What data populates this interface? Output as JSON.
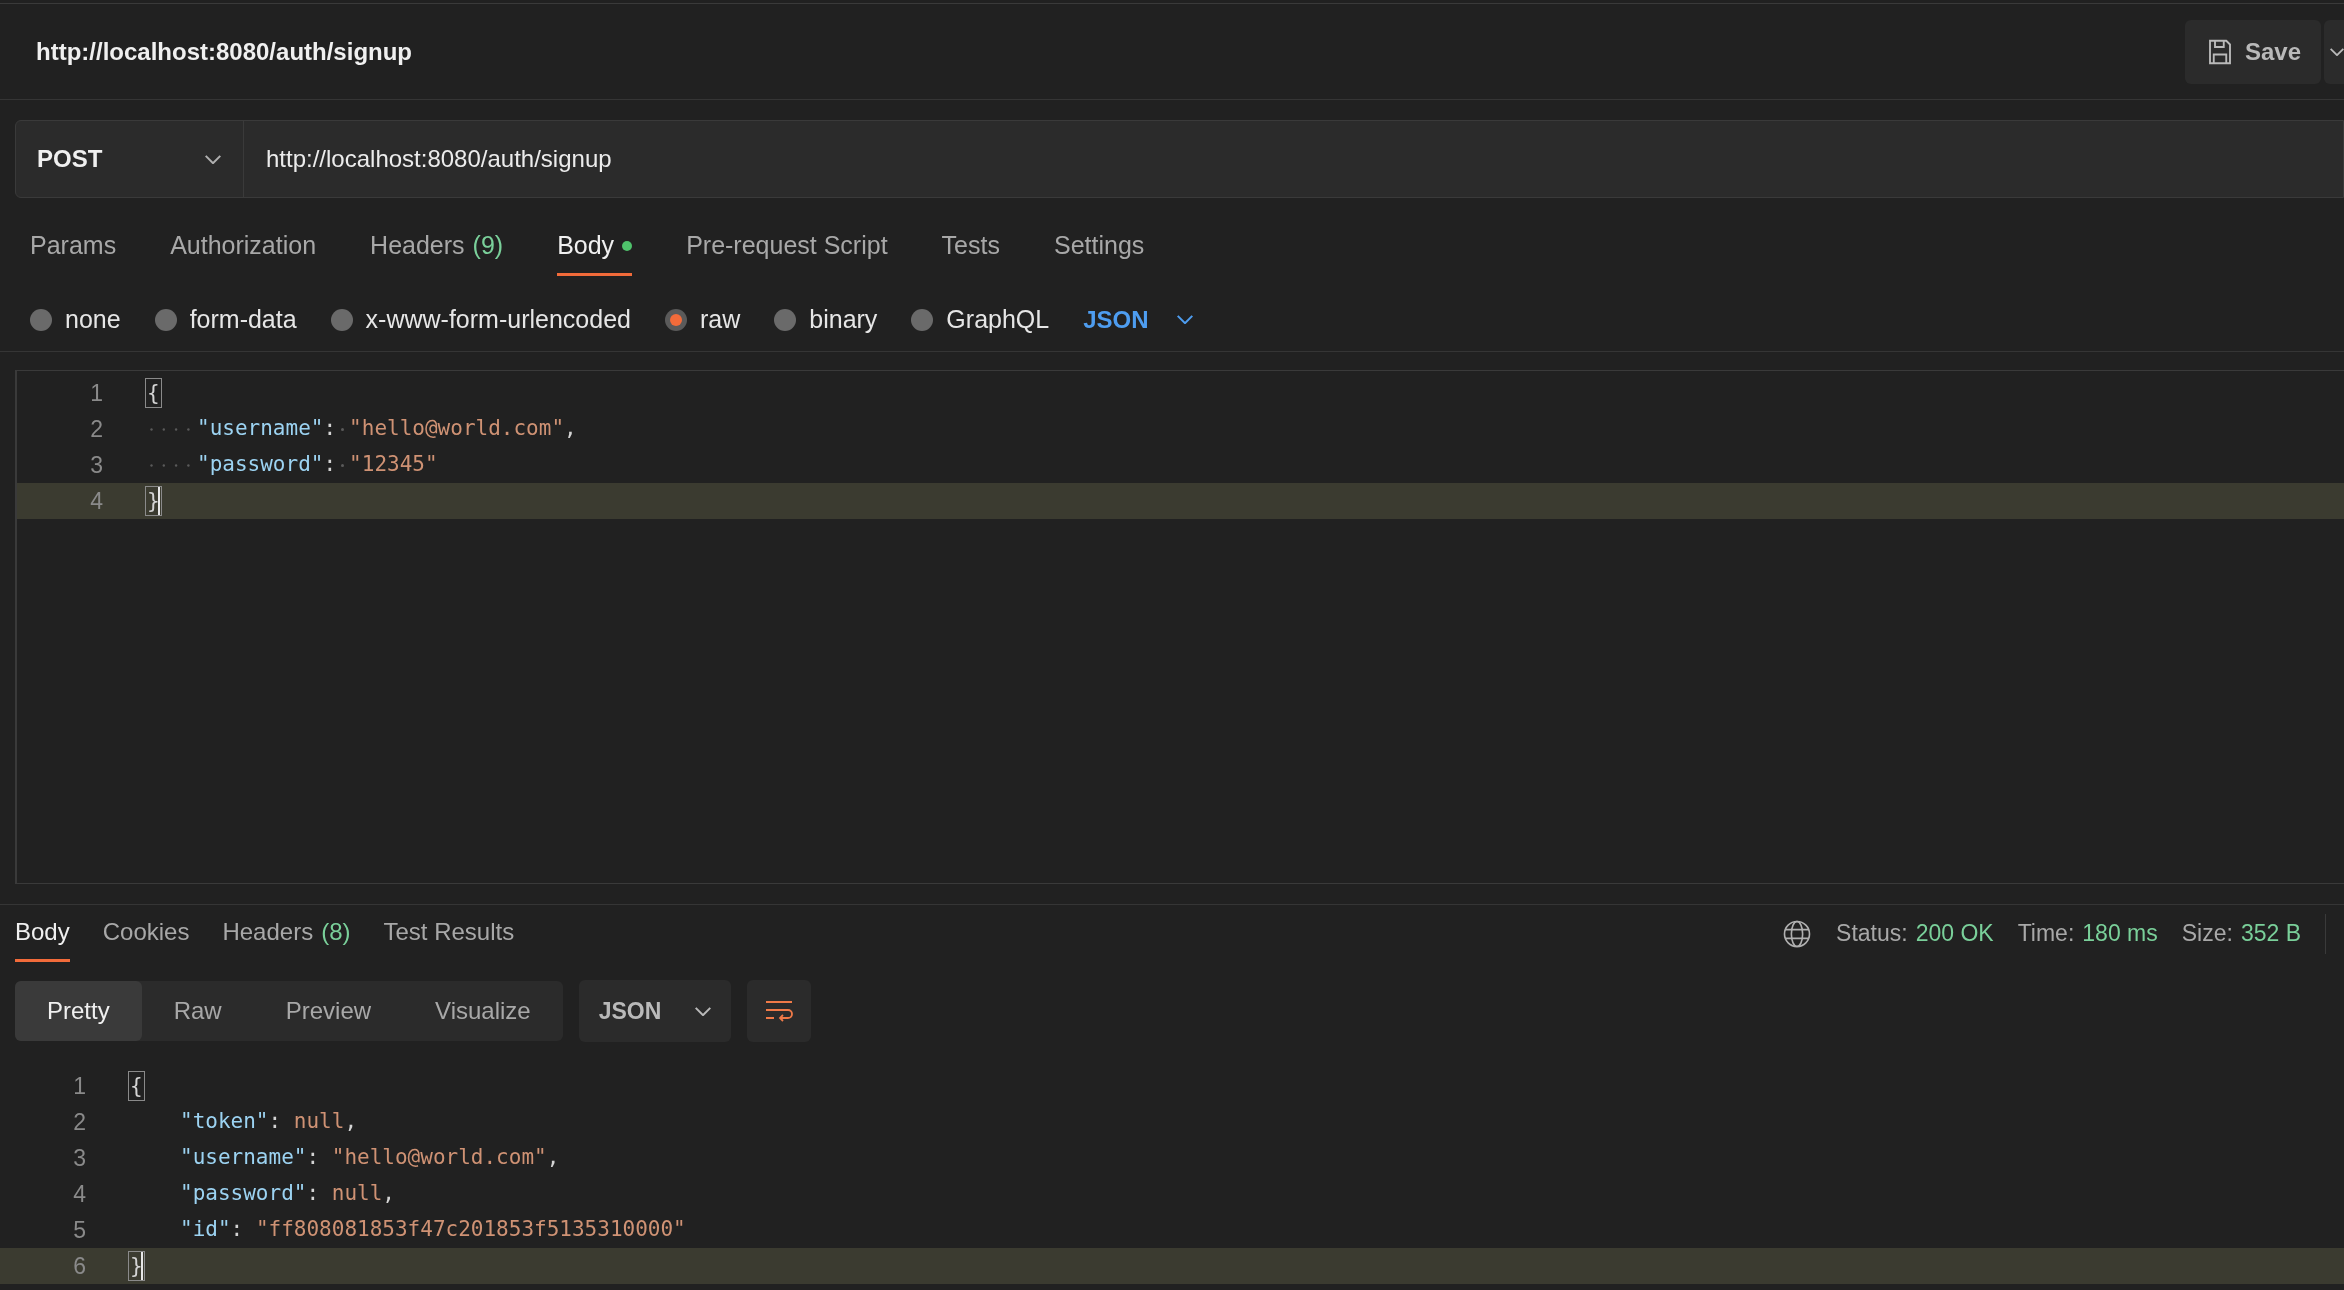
{
  "request_title": "http://localhost:8080/auth/signup",
  "save_button": {
    "label": "Save"
  },
  "method": "POST",
  "url": "http://localhost:8080/auth/signup",
  "request_tabs": [
    {
      "label": "Params",
      "selected": false
    },
    {
      "label": "Authorization",
      "selected": false
    },
    {
      "label": "Headers",
      "count": "(9)",
      "selected": false
    },
    {
      "label": "Body",
      "dot": true,
      "selected": true
    },
    {
      "label": "Pre-request Script",
      "selected": false
    },
    {
      "label": "Tests",
      "selected": false
    },
    {
      "label": "Settings",
      "selected": false
    }
  ],
  "body_types": [
    {
      "label": "none",
      "selected": false
    },
    {
      "label": "form-data",
      "selected": false
    },
    {
      "label": "x-www-form-urlencoded",
      "selected": false
    },
    {
      "label": "raw",
      "selected": true
    },
    {
      "label": "binary",
      "selected": false
    },
    {
      "label": "GraphQL",
      "selected": false
    }
  ],
  "body_format": "JSON",
  "request_editor": {
    "lines": [
      {
        "number": "1",
        "current": false,
        "indent": false,
        "tokens": [
          {
            "kind": "brace",
            "text": "{"
          }
        ]
      },
      {
        "number": "2",
        "current": false,
        "indent": true,
        "tokens": [
          {
            "kind": "key",
            "text": "\"username\""
          },
          {
            "kind": "punct",
            "text": ":"
          },
          {
            "kind": "string",
            "text": "\"hello@world.com\""
          },
          {
            "kind": "punct",
            "text": ","
          }
        ]
      },
      {
        "number": "3",
        "current": false,
        "indent": true,
        "tokens": [
          {
            "kind": "key",
            "text": "\"password\""
          },
          {
            "kind": "punct",
            "text": ":"
          },
          {
            "kind": "string",
            "text": "\"12345\""
          }
        ]
      },
      {
        "number": "4",
        "current": true,
        "indent": false,
        "tokens": [
          {
            "kind": "brace",
            "text": "}"
          }
        ]
      }
    ]
  },
  "response_tabs": [
    {
      "label": "Body",
      "selected": true
    },
    {
      "label": "Cookies",
      "selected": false
    },
    {
      "label": "Headers",
      "count": "(8)",
      "selected": false
    },
    {
      "label": "Test Results",
      "selected": false
    }
  ],
  "response_status": [
    {
      "label": "Status:",
      "value": "200 OK"
    },
    {
      "label": "Time:",
      "value": "180 ms"
    },
    {
      "label": "Size:",
      "value": "352 B"
    }
  ],
  "view_modes": [
    {
      "label": "Pretty",
      "selected": true
    },
    {
      "label": "Raw",
      "selected": false
    },
    {
      "label": "Preview",
      "selected": false
    },
    {
      "label": "Visualize",
      "selected": false
    }
  ],
  "response_format": "JSON",
  "response_editor": {
    "lines": [
      {
        "number": "1",
        "current": false,
        "indent": false,
        "tokens": [
          {
            "kind": "brace",
            "text": "{"
          }
        ]
      },
      {
        "number": "2",
        "current": false,
        "indent": true,
        "tokens": [
          {
            "kind": "key",
            "text": "\"token\""
          },
          {
            "kind": "punct",
            "text": ": "
          },
          {
            "kind": "string",
            "text": "null"
          },
          {
            "kind": "punct",
            "text": ","
          }
        ]
      },
      {
        "number": "3",
        "current": false,
        "indent": true,
        "tokens": [
          {
            "kind": "key",
            "text": "\"username\""
          },
          {
            "kind": "punct",
            "text": ": "
          },
          {
            "kind": "string",
            "text": "\"hello@world.com\""
          },
          {
            "kind": "punct",
            "text": ","
          }
        ]
      },
      {
        "number": "4",
        "current": false,
        "indent": true,
        "tokens": [
          {
            "kind": "key",
            "text": "\"password\""
          },
          {
            "kind": "punct",
            "text": ": "
          },
          {
            "kind": "string",
            "text": "null"
          },
          {
            "kind": "punct",
            "text": ","
          }
        ]
      },
      {
        "number": "5",
        "current": false,
        "indent": true,
        "tokens": [
          {
            "kind": "key",
            "text": "\"id\""
          },
          {
            "kind": "punct",
            "text": ": "
          },
          {
            "kind": "string",
            "text": "\"ff808081853f47c201853f5135310000\""
          }
        ]
      },
      {
        "number": "6",
        "current": true,
        "indent": false,
        "tokens": [
          {
            "kind": "brace",
            "text": "}"
          }
        ]
      }
    ]
  }
}
